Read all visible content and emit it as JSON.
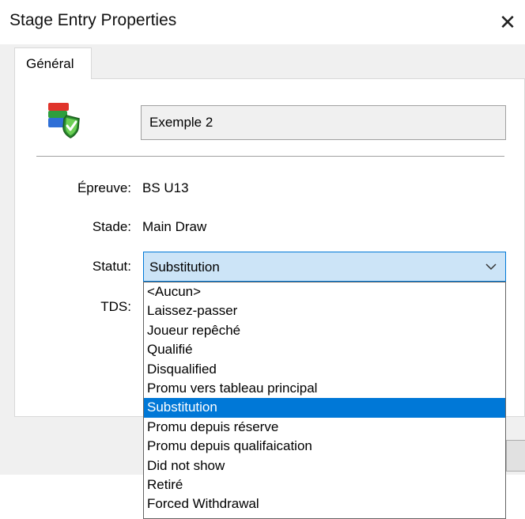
{
  "window": {
    "title": "Stage Entry Properties",
    "close_glyph": "✕"
  },
  "tabs": [
    {
      "label": "Général",
      "active": true
    }
  ],
  "entry": {
    "icon": "shield-check-icon",
    "name": "Exemple 2"
  },
  "fields": {
    "epreuve": {
      "label": "Épreuve:",
      "value": "BS U13"
    },
    "stade": {
      "label": "Stade:",
      "value": "Main Draw"
    },
    "statut": {
      "label": "Statut:",
      "value": "Substitution",
      "options": [
        "<Aucun>",
        "Laissez-passer",
        "Joueur repêché",
        "Qualifié",
        "Disqualified",
        "Promu vers tableau principal",
        "Substitution",
        "Promu depuis réserve",
        "Promu depuis qualifaication",
        "Did not show",
        "Retiré",
        "Forced Withdrawal"
      ],
      "selected_index": 6
    },
    "tds": {
      "label": "TDS:"
    }
  },
  "colors": {
    "accent": "#0078d7",
    "combo_bg": "#cce4f7",
    "dialog_bg": "#f0f0f0"
  }
}
